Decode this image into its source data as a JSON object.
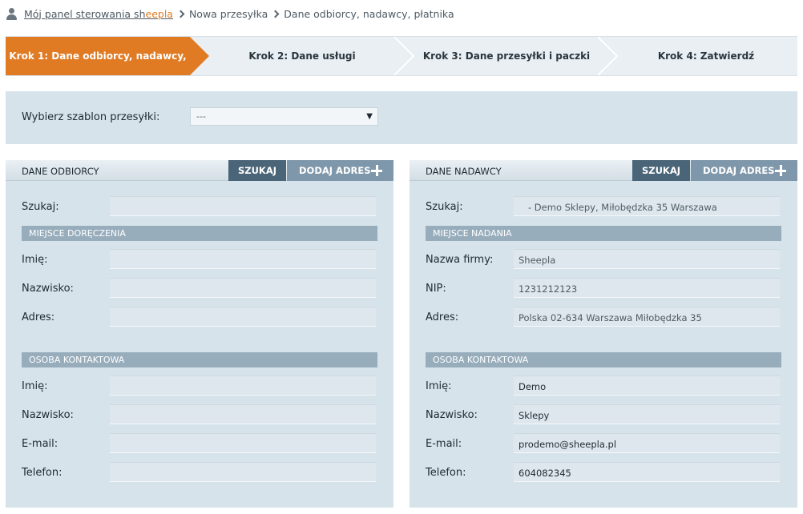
{
  "breadcrumb": {
    "home_prefix": "Mój panel sterowania sh",
    "home_brand": "eepla",
    "items": [
      "Nowa przesyłka",
      "Dane odbiorcy, nadawcy, płatnika"
    ]
  },
  "steps": [
    {
      "label": "Krok 1: Dane odbiorcy, nadawcy,",
      "active": true
    },
    {
      "label": "Krok 2: Dane usługi",
      "active": false
    },
    {
      "label": "Krok 3: Dane przesyłki i paczki",
      "active": false
    },
    {
      "label": "Krok 4: Zatwierdź",
      "active": false
    }
  ],
  "template": {
    "label": "Wybierz szablon przesyłki:",
    "selected": "---",
    "arrow": "▼"
  },
  "recipient": {
    "title": "DANE ODBIORCY",
    "search_btn": "SZUKAJ",
    "add_btn": "DODAJ ADRES",
    "search_label": "Szukaj:",
    "search_value": "",
    "delivery_section": "MIEJSCE DORĘCZENIA",
    "first_name_label": "Imię:",
    "first_name": "",
    "last_name_label": "Nazwisko:",
    "last_name": "",
    "address_label": "Adres:",
    "address": "",
    "contact_section": "OSOBA KONTAKTOWA",
    "contact_first_label": "Imię:",
    "contact_first": "",
    "contact_last_label": "Nazwisko:",
    "contact_last": "",
    "email_label": "E-mail:",
    "email": "",
    "phone_label": "Telefon:",
    "phone": ""
  },
  "sender": {
    "title": "DANE NADAWCY",
    "search_btn": "SZUKAJ",
    "add_btn": "DODAJ ADRES",
    "search_label": "Szukaj:",
    "search_value": "- Demo Sklepy, Miłobędzka 35 Warszawa",
    "origin_section": "MIEJSCE NADANIA",
    "company_label": "Nazwa firmy:",
    "company": "Sheepla",
    "nip_label": "NIP:",
    "nip": "1231212123",
    "address_label": "Adres:",
    "address": "Polska 02-634 Warszawa Miłobędzka 35",
    "contact_section": "OSOBA KONTAKTOWA",
    "contact_first_label": "Imię:",
    "contact_first": "Demo",
    "contact_last_label": "Nazwisko:",
    "contact_last": "Sklepy",
    "email_label": "E-mail:",
    "email": "prodemo@sheepla.pl",
    "phone_label": "Telefon:",
    "phone": "604082345"
  },
  "colors": {
    "accent": "#e07b24",
    "panel_bg": "#d7e3ea",
    "section_bar": "#98adbc",
    "search_button": "#4a6478",
    "add_button": "#7f97aa"
  }
}
